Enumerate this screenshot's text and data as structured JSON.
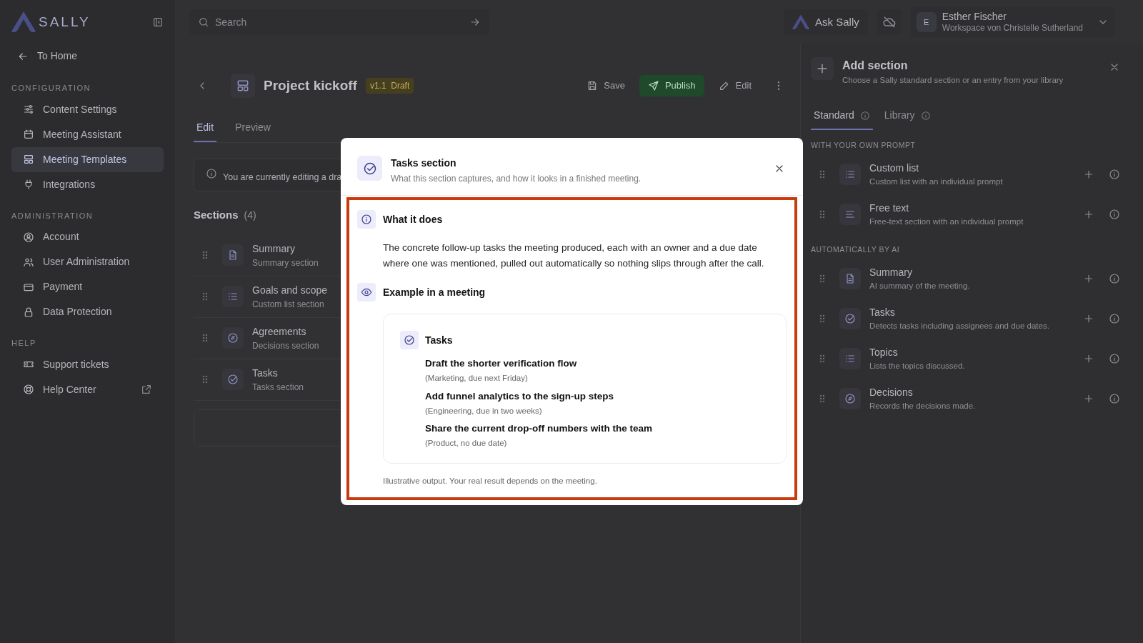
{
  "sidebar": {
    "logo": "SALLY",
    "back": "To Home",
    "groups": [
      {
        "heading": "CONFIGURATION",
        "items": [
          {
            "label": "Content Settings",
            "selected": false
          },
          {
            "label": "Meeting Assistant",
            "selected": false
          },
          {
            "label": "Meeting Templates",
            "selected": true
          },
          {
            "label": "Integrations",
            "selected": false
          }
        ]
      },
      {
        "heading": "ADMINISTRATION",
        "items": [
          {
            "label": "Account",
            "selected": false
          },
          {
            "label": "User Administration",
            "selected": false
          },
          {
            "label": "Payment",
            "selected": false
          },
          {
            "label": "Data Protection",
            "selected": false
          }
        ]
      },
      {
        "heading": "HELP",
        "items": [
          {
            "label": "Support tickets",
            "selected": false
          },
          {
            "label": "Help Center",
            "selected": false
          }
        ]
      }
    ]
  },
  "topbar": {
    "search": {
      "placeholder": "Search"
    },
    "ask": "Ask Sally",
    "avatar": "E",
    "user": "Esther Fischer",
    "workspace": "Workspace von Christelle Sutherland"
  },
  "editor": {
    "title": "Project kickoff",
    "version": "v1.1",
    "status": "Draft",
    "actions": [
      "Save",
      "Publish",
      "Edit"
    ],
    "tabs": [
      {
        "label": "Edit",
        "selected": true
      },
      {
        "label": "Preview",
        "selected": false
      }
    ],
    "notice": "You are currently editing a dra",
    "sections_heading": "Sections",
    "sections_count": "(4)",
    "sections": [
      {
        "title": "Summary",
        "subtitle": "Summary section"
      },
      {
        "title": "Goals and scope",
        "subtitle": "Custom list section"
      },
      {
        "title": "Agreements",
        "subtitle": "Decisions section"
      },
      {
        "title": "Tasks",
        "subtitle": "Tasks section"
      }
    ]
  },
  "add_panel": {
    "title": "Add section",
    "subtitle": "Choose a Sally standard section or an entry from your library",
    "tabs": [
      {
        "label": "Standard",
        "selected": true
      },
      {
        "label": "Library",
        "selected": false
      }
    ],
    "groups": [
      {
        "heading": "WITH YOUR OWN PROMPT",
        "items": [
          {
            "title": "Custom list",
            "subtitle": "Custom list with an individual prompt"
          },
          {
            "title": "Free text",
            "subtitle": "Free-text section with an individual prompt"
          }
        ]
      },
      {
        "heading": "AUTOMATICALLY BY AI",
        "items": [
          {
            "title": "Summary",
            "subtitle": "AI summary of the meeting."
          },
          {
            "title": "Tasks",
            "subtitle": "Detects tasks including assignees and due dates."
          },
          {
            "title": "Topics",
            "subtitle": "Lists the topics discussed."
          },
          {
            "title": "Decisions",
            "subtitle": "Records the decisions made."
          }
        ]
      }
    ]
  },
  "modal": {
    "title": "Tasks section",
    "subtitle": "What this section captures, and how it looks in a finished meeting.",
    "what_heading": "What it does",
    "what_text": "The concrete follow-up tasks the meeting produced, each with an owner and a due date where one was mentioned, pulled out automatically so nothing slips through after the call.",
    "example_heading": "Example in a meeting",
    "example": {
      "title": "Tasks",
      "tasks": [
        {
          "text": "Draft the shorter verification flow",
          "meta": "(Marketing, due next Friday)"
        },
        {
          "text": "Add funnel analytics to the sign-up steps",
          "meta": "(Engineering, due in two weeks)"
        },
        {
          "text": "Share the current drop-off numbers with the team",
          "meta": "(Product, no due date)"
        }
      ]
    },
    "footnote": "Illustrative output. Your real result depends on the meeting."
  }
}
